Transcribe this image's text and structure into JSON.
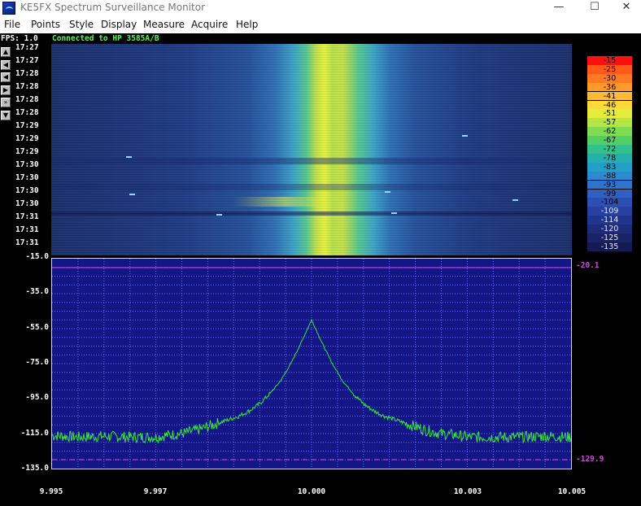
{
  "window": {
    "title": "KE5FX Spectrum Surveillance Monitor",
    "minimize_glyph": "—",
    "maximize_glyph": "☐",
    "close_glyph": "✕"
  },
  "menu": {
    "items": [
      "File",
      "Points",
      "Style",
      "Display",
      "Measure",
      "Acquire",
      "Help"
    ]
  },
  "status": {
    "fps": "FPS: 1.0",
    "connection": "Connected to HP 3585A/B"
  },
  "nav_buttons": [
    "▲",
    "◀",
    "◀",
    "▶",
    "»",
    "▼"
  ],
  "waterfall": {
    "time_labels": [
      "17:27",
      "17:27",
      "17:28",
      "17:28",
      "17:28",
      "17:28",
      "17:29",
      "17:29",
      "17:29",
      "17:30",
      "17:30",
      "17:30",
      "17:30",
      "17:31",
      "17:31",
      "17:31"
    ]
  },
  "color_scale": {
    "labels": [
      "-15",
      "-25",
      "-30",
      "-36",
      "-41",
      "-46",
      "-51",
      "-57",
      "-62",
      "-67",
      "-72",
      "-78",
      "-83",
      "-88",
      "-93",
      "-99",
      "-104",
      "-109",
      "-114",
      "-120",
      "-125",
      "-135"
    ],
    "colors": [
      "#ff1010",
      "#ff5a1a",
      "#ff7a22",
      "#ff9a2a",
      "#ffba33",
      "#ffd83c",
      "#e6ec3c",
      "#b4e646",
      "#7fdc52",
      "#52cf66",
      "#33c08c",
      "#26b0ad",
      "#239ec6",
      "#2b8ad2",
      "#2f73cf",
      "#3060c4",
      "#2b4fb3",
      "#2841a1",
      "#22358c",
      "#1d2b78",
      "#192366",
      "#151b52"
    ]
  },
  "chart_data": {
    "type": "line",
    "x_range": [
      9.995,
      10.005
    ],
    "y_range": [
      -135.0,
      -15.0
    ],
    "y_ticks": [
      "-15.0",
      "-35.0",
      "-55.0",
      "-75.0",
      "-95.0",
      "-115.0",
      "-135.0"
    ],
    "x_ticks": [
      "9.995",
      "9.997",
      "10.000",
      "10.003",
      "10.005"
    ],
    "x_tick_values": [
      9.995,
      9.997,
      10.0,
      10.003,
      10.005
    ],
    "grid": true,
    "markers": [
      {
        "label": "-20.1",
        "value": -20.1
      },
      {
        "label": "-129.9",
        "value": -129.9
      }
    ],
    "line_color": "#36e83a",
    "series": [
      {
        "x": [
          9.995,
          9.9955,
          9.996,
          9.9965,
          9.997,
          9.9972,
          9.9975,
          9.9978,
          9.998,
          9.9982,
          9.9984,
          9.9986,
          9.9988,
          9.999,
          9.9992,
          9.9994,
          9.9996,
          9.9998,
          10.0,
          10.0002,
          10.0004,
          10.0006,
          10.0008,
          10.001,
          10.0012,
          10.0014,
          10.0016,
          10.0018,
          10.002,
          10.0022,
          10.0025,
          10.0028,
          10.003,
          10.0035,
          10.004,
          10.0045,
          10.005
        ],
        "y": [
          -116,
          -117,
          -116.5,
          -117,
          -117,
          -116,
          -115,
          -113,
          -111,
          -109,
          -107,
          -105,
          -102,
          -98,
          -92,
          -85,
          -75,
          -63,
          -50,
          -63,
          -75,
          -85,
          -92,
          -98,
          -102,
          -105,
          -107,
          -109,
          -111,
          -113,
          -115,
          -116,
          -117,
          -117,
          -117,
          -116.5,
          -117
        ]
      }
    ]
  }
}
